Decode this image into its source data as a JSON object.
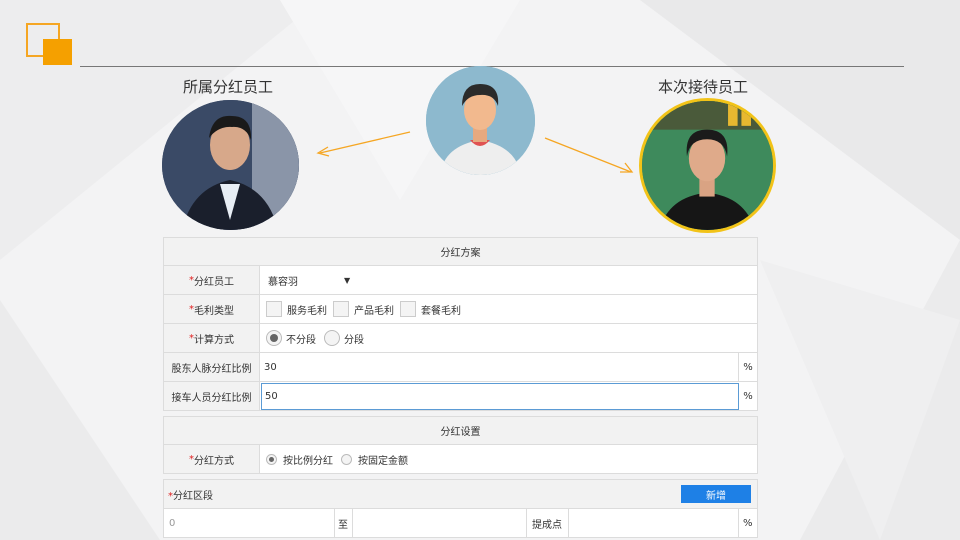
{
  "captions": {
    "left": "所属分红员工",
    "right": "本次接待员工"
  },
  "form": {
    "section1_title": "分红方案",
    "staff_label": "分红员工",
    "staff_value": "慕容羽",
    "margin_label": "毛利类型",
    "margin_options": [
      "服务毛利",
      "产品毛利",
      "套餐毛利"
    ],
    "calc_label": "计算方式",
    "calc_options": [
      {
        "label": "不分段",
        "selected": true
      },
      {
        "label": "分段",
        "selected": false
      }
    ],
    "shareholder_label": "股东人脉分红比例",
    "shareholder_value": "30",
    "reception_label": "接车人员分红比例",
    "reception_value": "50",
    "percent": "%",
    "section2_title": "分红设置",
    "method_label": "分红方式",
    "method_options": [
      {
        "label": "按比例分红",
        "selected": true
      },
      {
        "label": "按固定金额",
        "selected": false
      }
    ],
    "segment_label": "分红区段",
    "add_button": "新增",
    "range_from": "0",
    "range_to_label": "至",
    "commission_label": "提成点"
  },
  "colors": {
    "accent": "#f5a000",
    "button": "#1e80e6",
    "required": "#e02020",
    "active_border": "#5b9bd5"
  }
}
